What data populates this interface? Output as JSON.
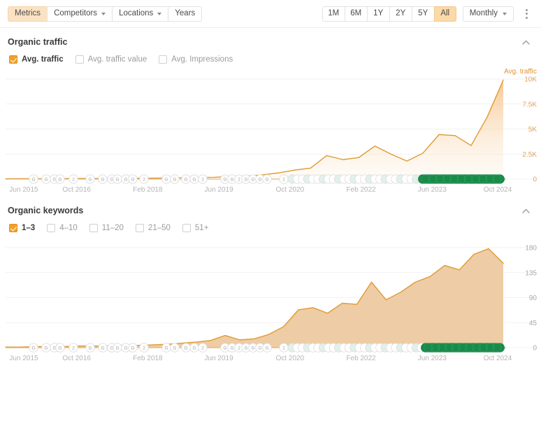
{
  "toolbar": {
    "tabs": [
      {
        "label": "Metrics",
        "active": true,
        "caret": false
      },
      {
        "label": "Competitors",
        "active": false,
        "caret": true
      },
      {
        "label": "Locations",
        "active": false,
        "caret": true
      },
      {
        "label": "Years",
        "active": false,
        "caret": false
      }
    ],
    "periods": [
      {
        "label": "1M",
        "active": false
      },
      {
        "label": "6M",
        "active": false
      },
      {
        "label": "1Y",
        "active": false
      },
      {
        "label": "2Y",
        "active": false
      },
      {
        "label": "5Y",
        "active": false
      },
      {
        "label": "All",
        "active": true
      }
    ],
    "granularity": "Monthly",
    "menu_icon": "kebab-menu-icon"
  },
  "sections": [
    {
      "title": "Organic traffic",
      "collapse_icon": "chevron-up-icon",
      "legend": [
        {
          "label": "Avg. traffic",
          "checked": true
        },
        {
          "label": "Avg. traffic value",
          "checked": false
        },
        {
          "label": "Avg. Impressions",
          "checked": false
        }
      ]
    },
    {
      "title": "Organic keywords",
      "collapse_icon": "chevron-up-icon",
      "legend": [
        {
          "label": "1–3",
          "checked": true
        },
        {
          "label": "4–10",
          "checked": false
        },
        {
          "label": "11–20",
          "checked": false
        },
        {
          "label": "21–50",
          "checked": false
        },
        {
          "label": "51+",
          "checked": false
        }
      ]
    }
  ],
  "colors": {
    "accent_orange": "#f0a029",
    "line_orange": "#e09a32",
    "fill_orange_top": "#f7c38a",
    "fill_orange_bottom": "#fdf3e7",
    "fill_tan": "#edc9a0",
    "event_green": "#1a8a4a",
    "tab_active_bg": "#fbe2c4",
    "period_active_bg": "#fbd9a8",
    "gridline": "#f1f1f1"
  },
  "chart_data": [
    {
      "type": "area",
      "title": "Organic traffic",
      "series_name": "Avg. traffic",
      "ylabel": "Avg. traffic",
      "xlabel": "",
      "grid": true,
      "legend_position": "top-left",
      "ylim": [
        0,
        10000
      ],
      "yticks": [
        10000,
        7500,
        5000,
        2500,
        0
      ],
      "ytick_labels": [
        "10K",
        "7.5K",
        "5K",
        "2.5K",
        "0"
      ],
      "xticks": [
        "Jun 2015",
        "Oct 2016",
        "Feb 2018",
        "Jun 2019",
        "Oct 2020",
        "Feb 2022",
        "Jun 2023",
        "Oct 2024"
      ],
      "x": [
        "Jun 2015",
        "Dec 2015",
        "Jun 2016",
        "Oct 2016",
        "Apr 2017",
        "Oct 2017",
        "Feb 2018",
        "Aug 2018",
        "Feb 2019",
        "Jun 2019",
        "Dec 2019",
        "Jun 2020",
        "Oct 2020",
        "Feb 2021",
        "Aug 2021",
        "Dec 2021",
        "Feb 2022",
        "May 2022",
        "Aug 2022",
        "Nov 2022",
        "Jan 2023",
        "Mar 2023",
        "Apr 2023",
        "Jun 2023",
        "Aug 2023",
        "Oct 2023",
        "Dec 2023",
        "Feb 2024",
        "Apr 2024",
        "Jun 2024",
        "Aug 2024",
        "Oct 2024"
      ],
      "values": [
        30,
        35,
        40,
        45,
        50,
        55,
        60,
        70,
        80,
        90,
        110,
        130,
        150,
        180,
        260,
        300,
        420,
        620,
        900,
        1100,
        2350,
        1950,
        2150,
        3300,
        2500,
        1800,
        2600,
        4450,
        4350,
        3350,
        6200,
        9900
      ]
    },
    {
      "type": "area",
      "title": "Organic keywords",
      "series_name": "1–3",
      "ylabel": "",
      "xlabel": "",
      "grid": true,
      "legend_position": "top-left",
      "ylim": [
        0,
        180
      ],
      "yticks": [
        180,
        135,
        90,
        45,
        0
      ],
      "ytick_labels": [
        "180",
        "135",
        "90",
        "45",
        "0"
      ],
      "xticks": [
        "Jun 2015",
        "Oct 2016",
        "Feb 2018",
        "Jun 2019",
        "Oct 2020",
        "Feb 2022",
        "Jun 2023",
        "Oct 2024"
      ],
      "x": [
        "Jun 2015",
        "Dec 2015",
        "Jun 2016",
        "Oct 2016",
        "Apr 2017",
        "Oct 2017",
        "Feb 2018",
        "Aug 2018",
        "Feb 2019",
        "Jun 2019",
        "Dec 2019",
        "Jun 2020",
        "Oct 2020",
        "Feb 2021",
        "Jun 2021",
        "Sep 2021",
        "Nov 2021",
        "Feb 2022",
        "May 2022",
        "Jul 2022",
        "Sep 2022",
        "Nov 2022",
        "Jan 2023",
        "Mar 2023",
        "May 2023",
        "Jun 2023",
        "Aug 2023",
        "Oct 2023",
        "Dec 2023",
        "Feb 2024",
        "Apr 2024",
        "Jun 2024",
        "Aug 2024",
        "Sep 2024",
        "Oct 2024"
      ],
      "values": [
        1,
        1,
        2,
        2,
        2,
        3,
        3,
        3,
        4,
        4,
        5,
        6,
        8,
        10,
        13,
        22,
        14,
        16,
        24,
        38,
        68,
        72,
        62,
        80,
        78,
        118,
        86,
        100,
        118,
        128,
        148,
        140,
        168,
        178,
        152
      ]
    }
  ],
  "events": {
    "marker_labels_left": [
      "G",
      "G",
      "G",
      "G",
      "2",
      "G",
      "G",
      "G",
      "G",
      "G",
      "G",
      "2",
      "G",
      "G",
      "G",
      "G",
      "2",
      "G",
      "G",
      "2",
      "G",
      "G",
      "G",
      "G",
      "2"
    ],
    "cluster_label": "google-update-cluster"
  }
}
